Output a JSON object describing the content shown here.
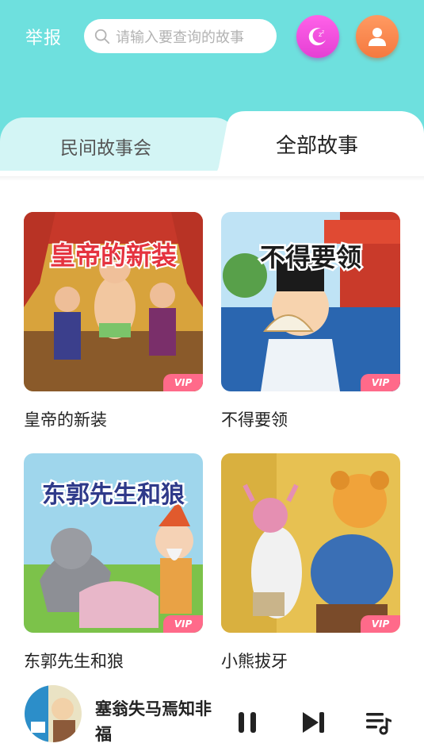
{
  "header": {
    "report_label": "举报",
    "search": {
      "placeholder": "请输入要查询的故事"
    },
    "night_mode_icon": "moon-icon",
    "profile_icon": "user-icon",
    "background_color": "#6ee0de"
  },
  "tabs": [
    {
      "label": "民间故事会",
      "selected": false
    },
    {
      "label": "全部故事",
      "selected": true
    }
  ],
  "stories": [
    {
      "title": "皇帝的新装",
      "cover_text": "皇帝的新装",
      "badge": "VIP"
    },
    {
      "title": "不得要领",
      "cover_text": "不得要领",
      "badge": "VIP"
    },
    {
      "title": "东郭先生和狼",
      "cover_text": "东郭先生和狼",
      "badge": "VIP"
    },
    {
      "title": "小熊拔牙",
      "cover_text": "",
      "badge": "VIP"
    }
  ],
  "player": {
    "title": "塞翁失马焉知非福",
    "state": "playing",
    "icons": [
      "pause-icon",
      "next-icon",
      "playlist-icon"
    ]
  },
  "colors": {
    "accent": "#6ee0de",
    "vip_badge": "#ff6a8a",
    "night_button": "#f04fdc",
    "profile_button": "#f7844a"
  }
}
